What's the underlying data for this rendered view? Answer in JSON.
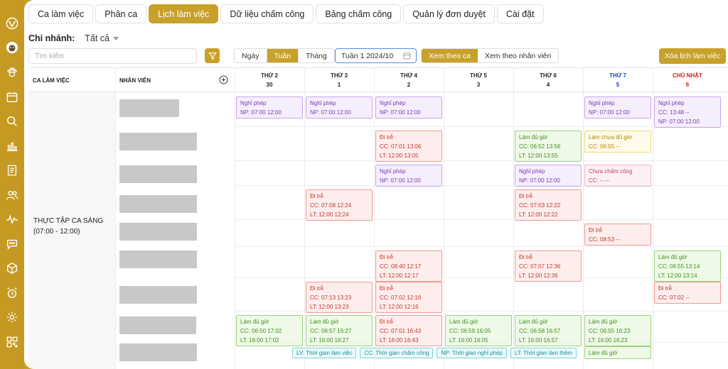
{
  "tabs": [
    {
      "label": "Ca làm việc"
    },
    {
      "label": "Phân ca"
    },
    {
      "label": "Lịch làm việc",
      "active": true
    },
    {
      "label": "Dữ liệu chấm công"
    },
    {
      "label": "Bảng chấm công"
    },
    {
      "label": "Quản lý đơn duyệt"
    },
    {
      "label": "Cài đặt"
    }
  ],
  "branch": {
    "label": "Chi nhánh:",
    "value": "Tất cả"
  },
  "search": {
    "placeholder": "Tìm kiếm"
  },
  "view_buttons": [
    {
      "label": "Ngày"
    },
    {
      "label": "Tuần",
      "active": true
    },
    {
      "label": "Tháng"
    }
  ],
  "week_picker": {
    "value": "Tuần 1 2024/10"
  },
  "mode_buttons": [
    {
      "label": "Xem theo ca",
      "active": true
    },
    {
      "label": "Xem theo nhân viên"
    }
  ],
  "clear_button": "Xóa lịch làm việc",
  "grid": {
    "col_shift": "CA LÀM VIỆC",
    "col_employee": "NHÂN VIÊN",
    "days": [
      {
        "name": "THỨ 2",
        "date": "30",
        "color": "#222222"
      },
      {
        "name": "THỨ 3",
        "date": "1",
        "color": "#222222"
      },
      {
        "name": "THỨ 4",
        "date": "2",
        "color": "#222222"
      },
      {
        "name": "THỨ 5",
        "date": "3",
        "color": "#222222"
      },
      {
        "name": "THỨ 6",
        "date": "4",
        "color": "#222222"
      },
      {
        "name": "THỨ 7",
        "date": "5",
        "color": "#1a3fc4"
      },
      {
        "name": "CHỦ NHẬT",
        "date": "6",
        "color": "#d0201a"
      }
    ],
    "shift": {
      "name": "THỰC TẬP CA SÁNG",
      "time": "(07:00 - 12:00)"
    }
  },
  "cards": [
    {
      "row": 0,
      "day": 0,
      "kind": "leave",
      "lines": [
        "Nghỉ phép",
        "NP: 07:00 12:00"
      ]
    },
    {
      "row": 0,
      "day": 1,
      "kind": "leave",
      "lines": [
        "Nghỉ phép",
        "NP: 07:00 12:00"
      ]
    },
    {
      "row": 0,
      "day": 2,
      "kind": "leave",
      "lines": [
        "Nghỉ phép",
        "NP: 07:00 12:00"
      ]
    },
    {
      "row": 0,
      "day": 5,
      "kind": "leave",
      "lines": [
        "Nghỉ phép",
        "NP: 07:00 12:00"
      ]
    },
    {
      "row": 0,
      "day": 6,
      "kind": "leave",
      "lines": [
        "Nghỉ phép",
        "CC: 13:48 --",
        "NP: 07:00 12:00"
      ]
    },
    {
      "row": 1,
      "day": 2,
      "kind": "late",
      "lines": [
        "Đi trễ",
        "CC: 07:01 13:06",
        "LT: 12:00 13:05"
      ]
    },
    {
      "row": 1,
      "day": 4,
      "kind": "ok",
      "lines": [
        "Làm đủ giờ",
        "CC: 06:52 13:56",
        "LT: 12:00 13:55"
      ]
    },
    {
      "row": 1,
      "day": 5,
      "kind": "short",
      "lines": [
        "Làm chưa đủ giờ",
        "CC: 06:55 --"
      ]
    },
    {
      "row": 2,
      "day": 2,
      "kind": "leave",
      "lines": [
        "Nghỉ phép",
        "NP: 07:00 12:00"
      ]
    },
    {
      "row": 2,
      "day": 4,
      "kind": "leave",
      "lines": [
        "Nghỉ phép",
        "NP: 07:00 12:00"
      ]
    },
    {
      "row": 2,
      "day": 5,
      "kind": "miss",
      "lines": [
        "Chưa chấm công",
        "CC: -- --"
      ]
    },
    {
      "row": 3,
      "day": 1,
      "kind": "late",
      "lines": [
        "Đi trễ",
        "CC: 07:08 12:24",
        "LT: 12:00 12:24"
      ]
    },
    {
      "row": 3,
      "day": 4,
      "kind": "late",
      "lines": [
        "Đi trễ",
        "CC: 07:03 12:22",
        "LT: 12:00 12:22"
      ]
    },
    {
      "row": 4,
      "day": 5,
      "kind": "late",
      "lines": [
        "Đi trễ",
        "CC: 08:53 --"
      ]
    },
    {
      "row": 5,
      "day": 2,
      "kind": "late",
      "lines": [
        "Đi trễ",
        "CC: 08:40 12:17",
        "LT: 12:00 12:17"
      ]
    },
    {
      "row": 5,
      "day": 4,
      "kind": "late",
      "lines": [
        "Đi trễ",
        "CC: 07:07 12:36",
        "LT: 12:00 12:36"
      ]
    },
    {
      "row": 5,
      "day": 6,
      "kind": "ok",
      "lines": [
        "Làm đủ giờ",
        "CC: 06:55 13:14",
        "LT: 12:00 13:14"
      ]
    },
    {
      "row": 6,
      "day": 1,
      "kind": "late",
      "lines": [
        "Đi trễ",
        "CC: 07:13 13:23",
        "LT: 12:00 13:23"
      ]
    },
    {
      "row": 6,
      "day": 2,
      "kind": "late",
      "lines": [
        "Đi trễ",
        "CC: 07:02 12:16",
        "LT: 12:00 12:16"
      ]
    },
    {
      "row": 6,
      "day": 6,
      "kind": "late",
      "lines": [
        "Đi trễ",
        "CC: 07:02 --"
      ]
    },
    {
      "row": 7,
      "day": 0,
      "kind": "ok",
      "lines": [
        "Làm đủ giờ",
        "CC: 06:50 17:02",
        "LT: 16:00 17:02"
      ]
    },
    {
      "row": 7,
      "day": 1,
      "kind": "ok",
      "lines": [
        "Làm đủ giờ",
        "CC: 06:57 16:27",
        "LT: 16:00 16:27"
      ]
    },
    {
      "row": 7,
      "day": 2,
      "kind": "late",
      "lines": [
        "Đi trễ",
        "CC: 07:01 16:43",
        "LT: 16:00 16:43"
      ]
    },
    {
      "row": 7,
      "day": 3,
      "kind": "ok",
      "lines": [
        "Làm đủ giờ",
        "CC: 06:59 16:05",
        "LT: 16:00 16:05"
      ]
    },
    {
      "row": 7,
      "day": 4,
      "kind": "ok",
      "lines": [
        "Làm đủ giờ",
        "CC: 06:58 16:57",
        "LT: 16:00 16:57"
      ]
    },
    {
      "row": 7,
      "day": 5,
      "kind": "ok",
      "lines": [
        "Làm đủ giờ",
        "CC: 06:55 16:23",
        "LT: 16:00 16:23"
      ]
    },
    {
      "row": 8,
      "day": 5,
      "kind": "ok",
      "lines": [
        "Làm đủ giờ"
      ]
    }
  ],
  "legend": [
    "LV: Thời gian làm việc",
    "CC: Thời gian chấm công",
    "NP: Thời gian nghỉ phép",
    "LT: Thời gian làm thêm"
  ],
  "colors": {
    "accent": "#c8a12b",
    "sidebar": "#c59a22"
  },
  "sidebar_icons": [
    "logo-icon",
    "avatar",
    "paw-icon",
    "calendar-icon",
    "search-icon",
    "bar-chart-icon",
    "document-icon",
    "users-icon",
    "activity-icon",
    "chat-icon",
    "box-icon",
    "alarm-clock-icon",
    "gear-icon",
    "qr-code-icon"
  ]
}
